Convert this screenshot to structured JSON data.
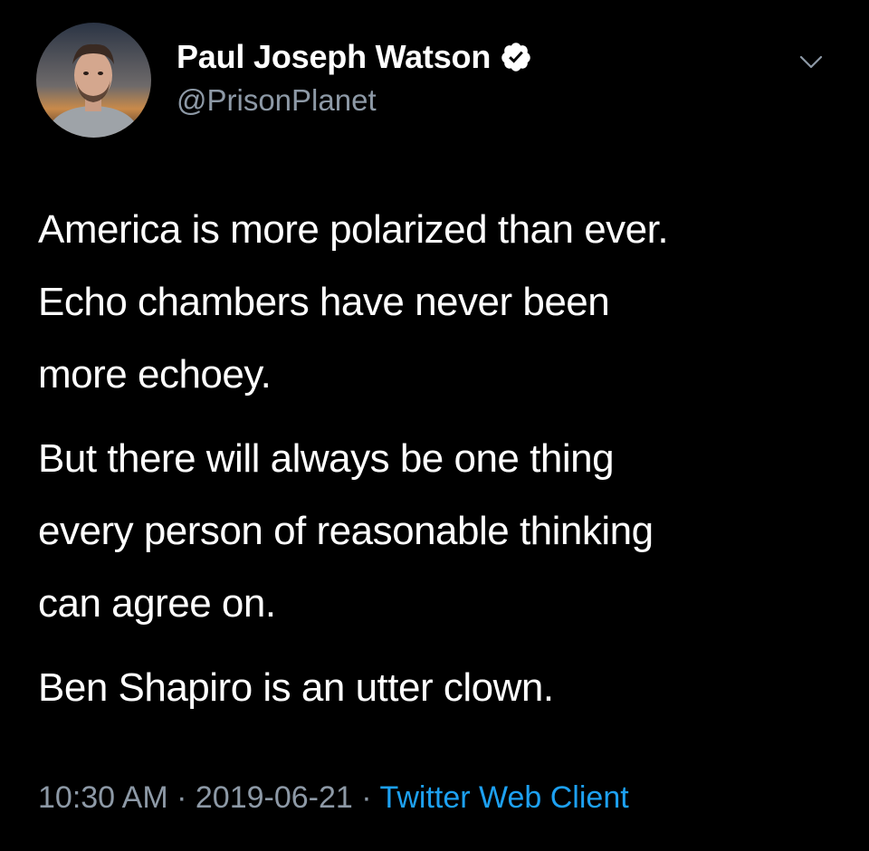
{
  "author": {
    "display_name": "Paul Joseph Watson",
    "handle": "@PrisonPlanet",
    "verified": true
  },
  "tweet": {
    "lines_p1": [
      "America is more polarized than ever.",
      "Echo chambers have never been",
      "more echoey."
    ],
    "lines_p2": [
      "But there will always be one thing",
      "every person of reasonable thinking",
      "can agree on."
    ],
    "lines_p3": [
      "Ben Shapiro is an utter clown."
    ]
  },
  "meta": {
    "time": "10:30 AM",
    "separator": "·",
    "date": "2019-06-21",
    "source": "Twitter Web Client"
  },
  "icons": {
    "verified": "verified-badge-icon",
    "more": "chevron-down-icon"
  },
  "colors": {
    "background": "#000000",
    "text": "#ffffff",
    "secondary": "#8d99a6",
    "link": "#1da1f2"
  }
}
